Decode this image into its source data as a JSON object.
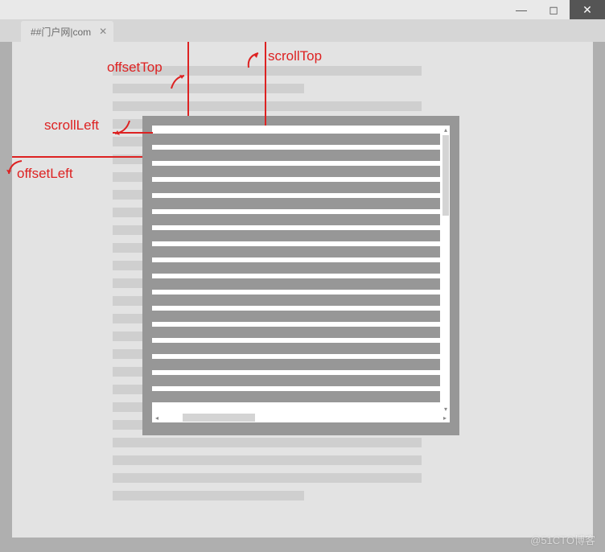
{
  "window": {
    "tab_title": "##门户网|com",
    "close_glyph": "✕",
    "min_glyph": "—",
    "max_glyph": "◻"
  },
  "labels": {
    "offsetTop": "offsetTop",
    "scrollTop": "scrollTop",
    "scrollLeft": "scrollLeft",
    "offsetLeft": "offsetLeft"
  },
  "watermark": "@51CTO博客"
}
